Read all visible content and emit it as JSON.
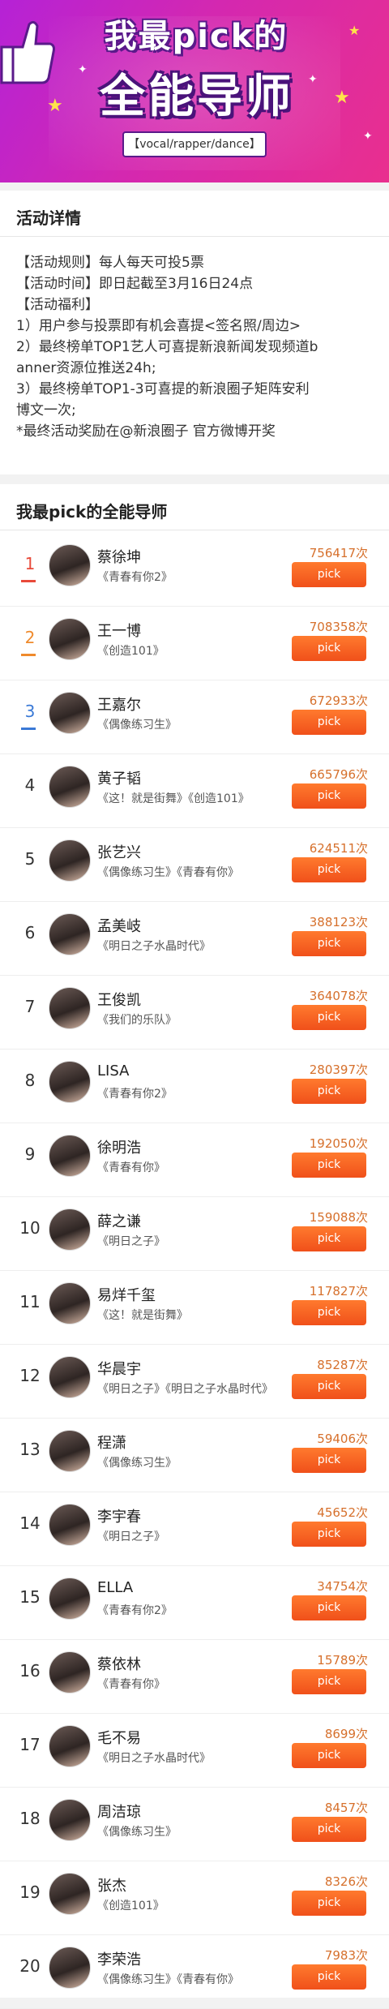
{
  "banner": {
    "line1": "我最pick的",
    "line2": "全能导师",
    "subtitle": "【vocal/rapper/dance】"
  },
  "details": {
    "title": "活动详情",
    "lines": [
      "【活动规则】每人每天可投5票",
      "【活动时间】即日起截至3月16日24点",
      "【活动福利】",
      "1）用户参与投票即有机会喜提<签名照/周边>",
      "2）最终榜单TOP1艺人可喜提新浪新闻发现频道b",
      "anner资源位推送24h;",
      "3）最终榜单TOP1-3可喜提的新浪圈子矩阵安利",
      "博文一次;",
      "*最终活动奖励在@新浪圈子 官方微博开奖"
    ]
  },
  "ranking": {
    "title": "我最pick的全能导师",
    "pick_label": "pick",
    "items": [
      {
        "rank": "1",
        "name": "蔡徐坤",
        "works": "《青春有你2》",
        "votes": "756417次"
      },
      {
        "rank": "2",
        "name": "王一博",
        "works": "《创造101》",
        "votes": "708358次"
      },
      {
        "rank": "3",
        "name": "王嘉尔",
        "works": "《偶像练习生》",
        "votes": "672933次"
      },
      {
        "rank": "4",
        "name": "黄子韬",
        "works": "《这！就是街舞》《创造101》",
        "votes": "665796次"
      },
      {
        "rank": "5",
        "name": "张艺兴",
        "works": "《偶像练习生》《青春有你》",
        "votes": "624511次"
      },
      {
        "rank": "6",
        "name": "孟美岐",
        "works": "《明日之子水晶时代》",
        "votes": "388123次"
      },
      {
        "rank": "7",
        "name": "王俊凯",
        "works": "《我们的乐队》",
        "votes": "364078次"
      },
      {
        "rank": "8",
        "name": "LISA",
        "works": "《青春有你2》",
        "votes": "280397次"
      },
      {
        "rank": "9",
        "name": "徐明浩",
        "works": "《青春有你》",
        "votes": "192050次"
      },
      {
        "rank": "10",
        "name": "薛之谦",
        "works": "《明日之子》",
        "votes": "159088次"
      },
      {
        "rank": "11",
        "name": "易烊千玺",
        "works": "《这！就是街舞》",
        "votes": "117827次"
      },
      {
        "rank": "12",
        "name": "华晨宇",
        "works": "《明日之子》《明日之子水晶时代》",
        "votes": "85287次"
      },
      {
        "rank": "13",
        "name": "程潇",
        "works": "《偶像练习生》",
        "votes": "59406次"
      },
      {
        "rank": "14",
        "name": "李宇春",
        "works": "《明日之子》",
        "votes": "45652次"
      },
      {
        "rank": "15",
        "name": "ELLA",
        "works": "《青春有你2》",
        "votes": "34754次"
      },
      {
        "rank": "16",
        "name": "蔡依林",
        "works": "《青春有你》",
        "votes": "15789次"
      },
      {
        "rank": "17",
        "name": "毛不易",
        "works": "《明日之子水晶时代》",
        "votes": "8699次"
      },
      {
        "rank": "18",
        "name": "周洁琼",
        "works": "《偶像练习生》",
        "votes": "8457次"
      },
      {
        "rank": "19",
        "name": "张杰",
        "works": "《创造101》",
        "votes": "8326次"
      },
      {
        "rank": "20",
        "name": "李荣浩",
        "works": "《偶像练习生》《青春有你》",
        "votes": "7983次"
      }
    ]
  },
  "colors": {
    "accent": "#f0501a",
    "vote_text": "#d6702c",
    "banner_purple": "#b522d6",
    "banner_pink": "#e92f8e"
  }
}
